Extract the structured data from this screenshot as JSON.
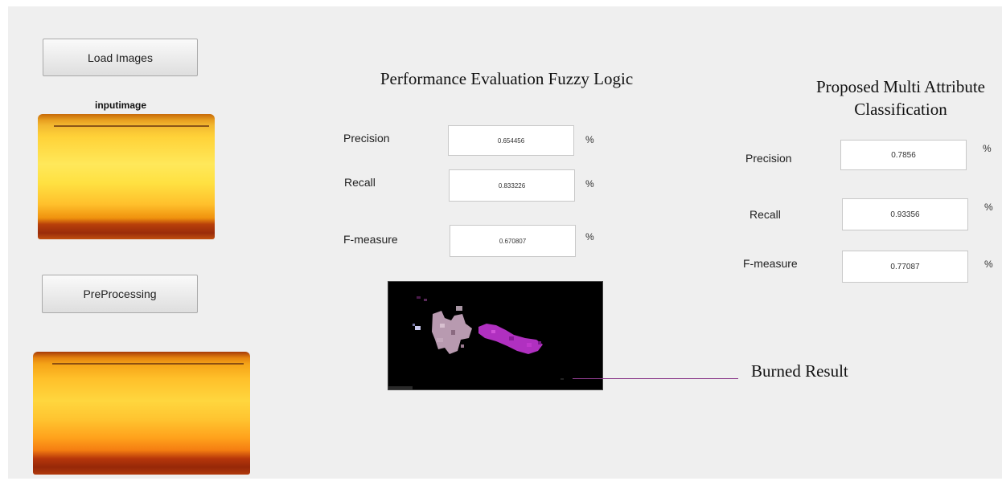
{
  "buttons": {
    "load_images": "Load Images",
    "preprocessing": "PreProcessing"
  },
  "input_image": {
    "title": "inputimage"
  },
  "fuzzy": {
    "title": "Performance Evaluation Fuzzy Logic",
    "precision_label": "Precision",
    "precision_value": "0.654456",
    "recall_label": "Recall",
    "recall_value": "0.833226",
    "fmeasure_label": "F-measure",
    "fmeasure_value": "0.670807",
    "unit": "%"
  },
  "proposed": {
    "title_line1": "Proposed Multi Attribute",
    "title_line2": "Classification",
    "precision_label": "Precision",
    "precision_value": "0.7856",
    "recall_label": "Recall",
    "recall_value": "0.93356",
    "fmeasure_label": "F-measure",
    "fmeasure_value": "0.77087",
    "unit": "%"
  },
  "result": {
    "label": "Burned Result"
  },
  "colors": {
    "panel_bg": "#efefef",
    "result_bg": "#000000",
    "burn_magenta": "#b030c0",
    "burn_lavender": "#b89ab0",
    "callout_line": "#8a3a8a"
  }
}
